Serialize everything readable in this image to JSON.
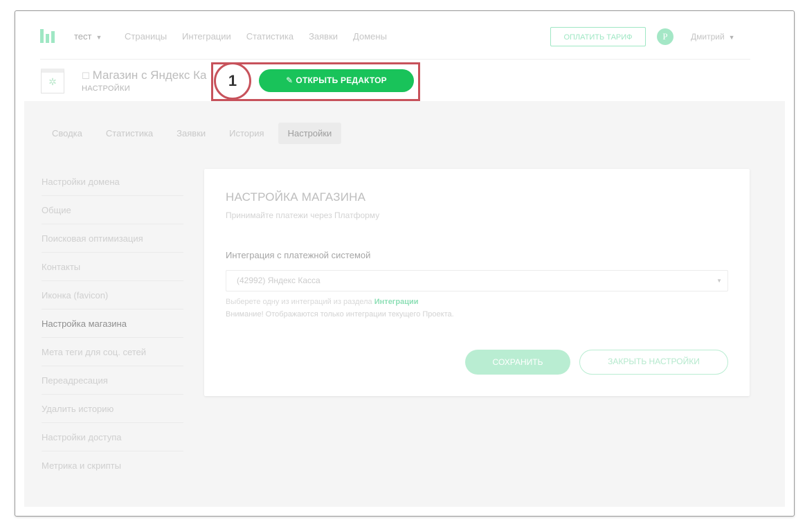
{
  "topnav": {
    "project": "тест",
    "project_caret": "▼",
    "links": [
      "Страницы",
      "Интеграции",
      "Статистика",
      "Заявки",
      "Домены"
    ],
    "pay_button": "ОПЛАТИТЬ ТАРИФ",
    "avatar_letter": "P",
    "username": "Дмитрий",
    "user_caret": "▼"
  },
  "page": {
    "title": "Магазин с Яндекс Ка",
    "subtitle": "НАСТРОЙКИ",
    "editor_button": "ОТКРЫТЬ РЕДАКТОР",
    "step_number": "1"
  },
  "tabs": [
    "Сводка",
    "Статистика",
    "Заявки",
    "История",
    "Настройки"
  ],
  "active_tab": "Настройки",
  "sidemenu": [
    "Настройки домена",
    "Общие",
    "Поисковая оптимизация",
    "Контакты",
    "Иконка (favicon)",
    "Настройка магазина",
    "Мета теги для соц. сетей",
    "Переадресация",
    "Удалить историю",
    "Настройки доступа",
    "Метрика и скрипты"
  ],
  "active_side": "Настройка магазина",
  "card": {
    "title": "НАСТРОЙКА МАГАЗИНА",
    "subtitle": "Принимайте платежи через Платформу",
    "field_label": "Интеграция с платежной системой",
    "select_value": "(42992) Яндекс Касса",
    "hint_prefix": "Выберете одну из интеграций из раздела",
    "hint_link": "Интеграции",
    "hint_warning": "Внимание! Отображаются только интеграции текущего Проекта.",
    "save_button": "СОХРАНИТЬ",
    "close_button": "ЗАКРЫТЬ НАСТРОЙКИ"
  },
  "colors": {
    "accent": "#19c35a",
    "accent_faded": "#9fe7c4",
    "highlight": "#c7525b",
    "content_bg": "#f5f5f5"
  }
}
